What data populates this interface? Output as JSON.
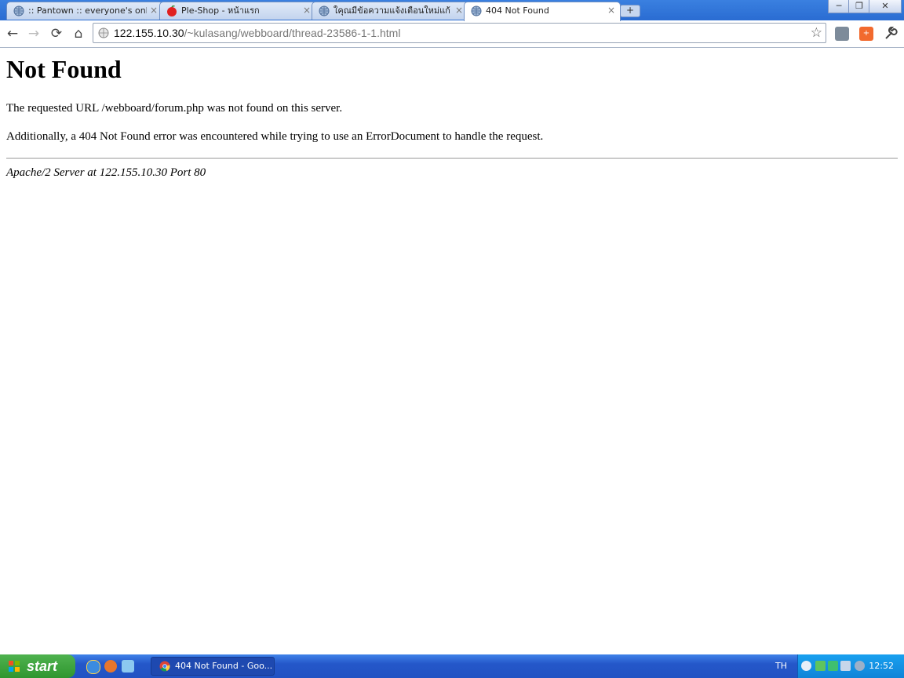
{
  "browser": {
    "tabs": [
      {
        "title": ":: Pantown :: everyone's onlin",
        "icon": "globe-icon"
      },
      {
        "title": "Ple-Shop - หน้าแรก",
        "icon": "apple-icon"
      },
      {
        "title": "ใคุณมีข้อความแจ้งเตือนใหม่แก้",
        "icon": "globe-icon"
      },
      {
        "title": "404 Not Found",
        "icon": "globe-icon"
      }
    ],
    "active_tab_index": 3,
    "tab_close_glyph": "×",
    "new_tab_glyph": "+",
    "window_controls": {
      "minimize": "─",
      "restore": "❐",
      "close": "✕"
    },
    "nav": {
      "back": "←",
      "forward": "→",
      "reload": "⟳",
      "home": "⌂"
    },
    "address": {
      "host": "122.155.10.30",
      "path": "/~kulasang/webboard/thread-23586-1-1.html"
    },
    "bookmark_star": "☆"
  },
  "page": {
    "heading": "Not Found",
    "message": "The requested URL /webboard/forum.php was not found on this server.",
    "additional": "Additionally, a 404 Not Found error was encountered while trying to use an ErrorDocument to handle the request.",
    "server_signature": "Apache/2 Server at 122.155.10.30 Port 80"
  },
  "taskbar": {
    "start_label": "start",
    "task_label": "404 Not Found - Goo...",
    "language": "TH",
    "clock": "12:52"
  },
  "colors": {
    "titlebar": "#2a6cd2",
    "taskbar": "#2457c9",
    "start_green": "#3aa23a",
    "tray": "#0f84d8"
  }
}
